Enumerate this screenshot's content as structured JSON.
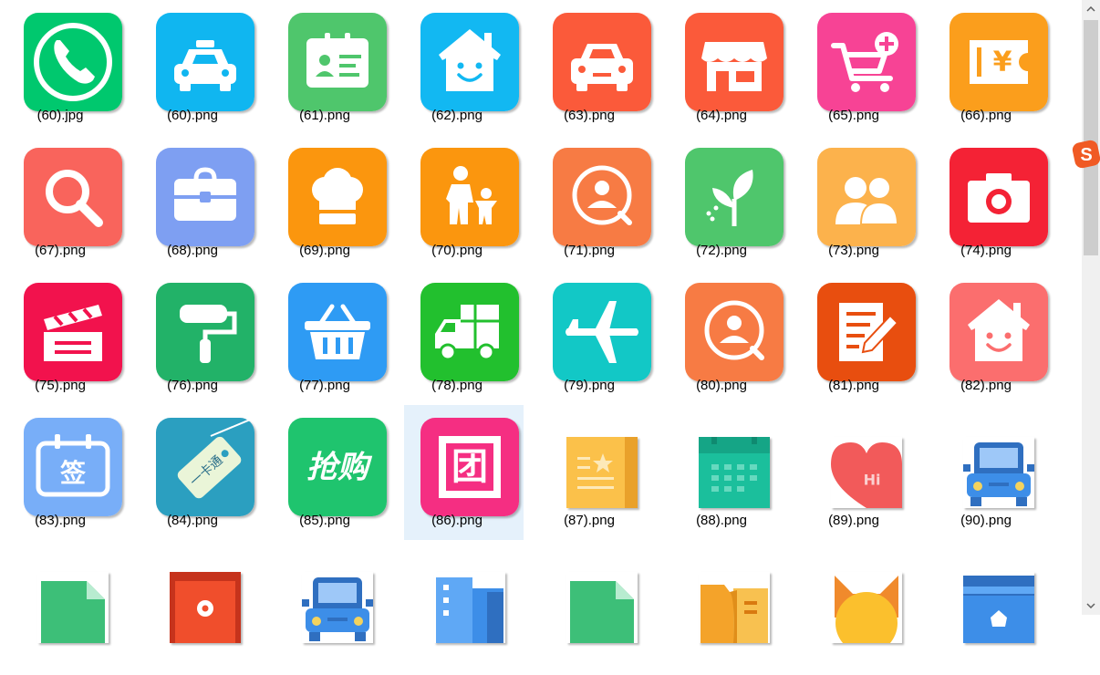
{
  "files": [
    {
      "label": "(60).jpg",
      "icon": "phone-icon",
      "color": "#00c86e"
    },
    {
      "label": "(60).png",
      "icon": "taxi-icon",
      "color": "#10b6f0"
    },
    {
      "label": "(61).png",
      "icon": "id-card-icon",
      "color": "#4fc66c"
    },
    {
      "label": "(62).png",
      "icon": "smiling-house-icon",
      "color": "#12b8f2"
    },
    {
      "label": "(63).png",
      "icon": "car-icon",
      "color": "#fb5a3a"
    },
    {
      "label": "(64).png",
      "icon": "shop-icon",
      "color": "#fb5a3a"
    },
    {
      "label": "(65).png",
      "icon": "cart-add-icon",
      "color": "#f74395"
    },
    {
      "label": "(66).png",
      "icon": "yuan-ticket-icon",
      "color": "#fb9e1c"
    },
    {
      "label": "(67).png",
      "icon": "search-icon",
      "color": "#f9645c"
    },
    {
      "label": "(68).png",
      "icon": "toolbox-icon",
      "color": "#7e9ff2"
    },
    {
      "label": "(69).png",
      "icon": "chef-hat-icon",
      "color": "#fb960e"
    },
    {
      "label": "(70).png",
      "icon": "parent-child-icon",
      "color": "#fb960e"
    },
    {
      "label": "(71).png",
      "icon": "user-search-icon",
      "color": "#f77b44"
    },
    {
      "label": "(72).png",
      "icon": "sprout-icon",
      "color": "#4fc66c"
    },
    {
      "label": "(73).png",
      "icon": "users-icon",
      "color": "#fcb24c"
    },
    {
      "label": "(74).png",
      "icon": "camera-icon",
      "color": "#f42235"
    },
    {
      "label": "(75).png",
      "icon": "clapperboard-icon",
      "color": "#f2124d"
    },
    {
      "label": "(76).png",
      "icon": "paint-roller-icon",
      "color": "#22b268"
    },
    {
      "label": "(77).png",
      "icon": "basket-icon",
      "color": "#2e9bf4"
    },
    {
      "label": "(78).png",
      "icon": "delivery-truck-icon",
      "color": "#22c02e"
    },
    {
      "label": "(79).png",
      "icon": "airplane-icon",
      "color": "#12c8c6"
    },
    {
      "label": "(80).png",
      "icon": "user-search-icon",
      "color": "#f77b44"
    },
    {
      "label": "(81).png",
      "icon": "document-edit-icon",
      "color": "#e84e0f"
    },
    {
      "label": "(82).png",
      "icon": "smiling-house-icon",
      "color": "#fb6e6e"
    },
    {
      "label": "(83).png",
      "icon": "sign-in-calendar-icon",
      "color": "#78aef8"
    },
    {
      "label": "(84).png",
      "icon": "card-tag-icon",
      "color": "#2b9fc0"
    },
    {
      "label": "(85).png",
      "icon": "flash-sale-icon",
      "color": "#1fc46e"
    },
    {
      "label": "(86).png",
      "icon": "group-buy-icon",
      "color": "#f52e82"
    },
    {
      "label": "(87).png",
      "icon": "document-star-icon",
      "color": "#fbc14a"
    },
    {
      "label": "(88).png",
      "icon": "calendar-icon",
      "color": "#1bbf9c"
    },
    {
      "label": "(89).png",
      "icon": "heart-hi-icon",
      "color": "#f25a5a"
    },
    {
      "label": "(90).png",
      "icon": "truck-front-icon",
      "color": "#3d8ee8"
    },
    {
      "label": "",
      "icon": "green-document-icon",
      "color": "#3dbf78"
    },
    {
      "label": "",
      "icon": "location-card-icon",
      "color": "#f04e2c"
    },
    {
      "label": "",
      "icon": "truck-front-icon",
      "color": "#3d8ee8"
    },
    {
      "label": "",
      "icon": "building-icon",
      "color": "#3d8ee8"
    },
    {
      "label": "",
      "icon": "green-document-icon",
      "color": "#3dbf78"
    },
    {
      "label": "",
      "icon": "folder-icon",
      "color": "#f8b034"
    },
    {
      "label": "",
      "icon": "cat-face-icon",
      "color": "#fbc02d"
    },
    {
      "label": "",
      "icon": "wallet-icon",
      "color": "#3d8ee8"
    }
  ],
  "selected_label": "(86).png",
  "glyphs": {
    "yuan": "¥",
    "sign": "签",
    "yika": "一卡通",
    "qianggou": "抢购",
    "tuan": "团",
    "hi": "Hi",
    "ime_logo": "S"
  },
  "colors": {
    "selection": "#e5f1fb",
    "scroll_track": "#f0f0f0",
    "scroll_thumb": "#cdcdcd",
    "ime": "#f05a24"
  }
}
